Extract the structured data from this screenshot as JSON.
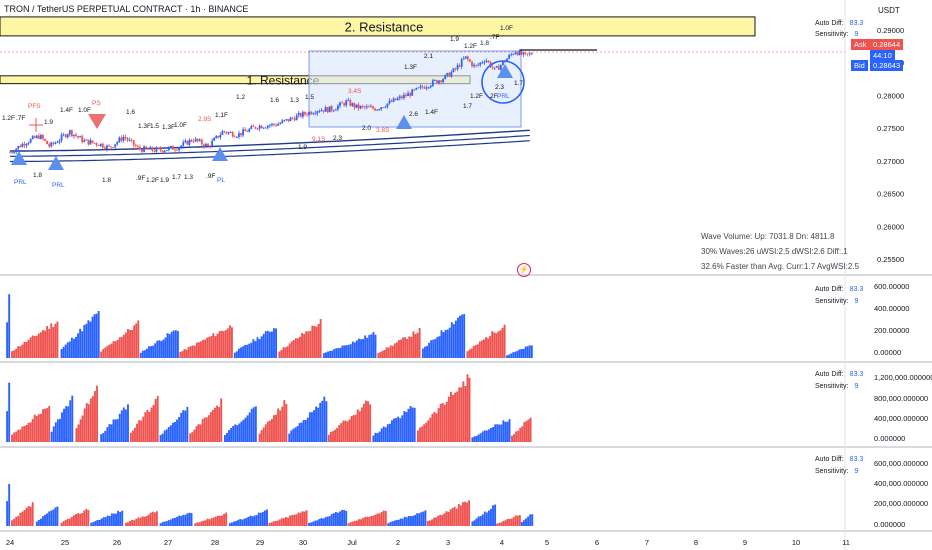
{
  "header": {
    "symbol_title": "TRON / TetherUS PERPETUAL CONTRACT · 1h · BINANCE",
    "currency": "USDT"
  },
  "colors": {
    "up": "#2962ff",
    "down": "#ef5350",
    "resistance_fill": "#fdf6a3",
    "box_fill": "#dbe6fb",
    "box_border": "#7b9df0"
  },
  "indicator_settings": {
    "auto_diff_label": "Auto Diff:",
    "auto_diff_value": "83.3",
    "sensitivity_label": "Sensitivity:",
    "sensitivity_value": "9"
  },
  "quotes": {
    "ask_label": "Ask",
    "ask_value": "0.28644",
    "countdown": "44:10",
    "bid_label": "Bid",
    "bid_value": "0.28643"
  },
  "wave_stats": {
    "line1": "Wave Volume: Up: 7031.8 Dn: 4811.8",
    "line2": "30% Waves:26 uWSI:2.5 dWSI:2.6 Diff:.1",
    "line3": "32.6% Faster than Avg. Curr:1.7 AvgWSI:2.5"
  },
  "chart_data": [
    {
      "type": "candlestick",
      "title": "TRON / TetherUS PERPETUAL CONTRACT · 1h · BINANCE",
      "x_ticks": [
        "24",
        "25",
        "26",
        "27",
        "28",
        "29",
        "30",
        "Jul",
        "2",
        "3",
        "4",
        "5",
        "6",
        "7",
        "8",
        "9",
        "10",
        "11"
      ],
      "y_ticks": [
        "0.29000",
        "0.28500",
        "0.28000",
        "0.27500",
        "0.27000",
        "0.26500",
        "0.26000",
        "0.25500"
      ],
      "ylim": [
        0.2515,
        0.2925
      ],
      "close_path": [
        [
          24.0,
          0.2713
        ],
        [
          24.3,
          0.2728
        ],
        [
          24.6,
          0.2738
        ],
        [
          24.8,
          0.2722
        ],
        [
          25.0,
          0.2733
        ],
        [
          25.2,
          0.2745
        ],
        [
          25.5,
          0.273
        ],
        [
          25.8,
          0.2726
        ],
        [
          26.0,
          0.272
        ],
        [
          26.3,
          0.2737
        ],
        [
          26.6,
          0.2718
        ],
        [
          27.0,
          0.2716
        ],
        [
          27.4,
          0.2721
        ],
        [
          27.7,
          0.2733
        ],
        [
          28.0,
          0.2722
        ],
        [
          28.3,
          0.2745
        ],
        [
          28.6,
          0.274
        ],
        [
          29.0,
          0.2753
        ],
        [
          29.4,
          0.2756
        ],
        [
          29.8,
          0.2768
        ],
        [
          30.2,
          0.2778
        ],
        [
          30.5,
          0.2779
        ],
        [
          30.8,
          0.279
        ],
        [
          31.0,
          0.2782
        ],
        [
          31.4,
          0.278
        ],
        [
          31.7,
          0.279
        ],
        [
          32.0,
          0.28
        ],
        [
          32.4,
          0.2815
        ],
        [
          32.8,
          0.2828
        ],
        [
          33.0,
          0.284
        ],
        [
          33.2,
          0.2858
        ],
        [
          33.4,
          0.2843
        ],
        [
          33.6,
          0.2856
        ],
        [
          33.8,
          0.2838
        ],
        [
          34.0,
          0.2853
        ],
        [
          34.2,
          0.2868
        ],
        [
          34.4,
          0.286
        ],
        [
          34.55,
          0.2864
        ]
      ],
      "annotations": [
        {
          "label": "2. Resistance",
          "kind": "zone",
          "y_range": [
            0.2891,
            0.292
          ]
        },
        {
          "label": "1. Resistance",
          "kind": "zone",
          "y_range": [
            0.2818,
            0.283
          ]
        }
      ]
    },
    {
      "type": "bar",
      "title": "",
      "y_ticks": [
        "600.00000",
        "400.00000",
        "200.00000",
        "0.00000"
      ],
      "ylim": [
        0,
        650
      ],
      "peaks": [
        {
          "x": 24.0,
          "value": 630
        },
        {
          "x": 25.0,
          "value": 350
        },
        {
          "x": 25.8,
          "value": 420
        },
        {
          "x": 26.6,
          "value": 320
        },
        {
          "x": 27.4,
          "value": 270
        },
        {
          "x": 28.5,
          "value": 300
        },
        {
          "x": 29.4,
          "value": 290
        },
        {
          "x": 30.3,
          "value": 340
        },
        {
          "x": 31.4,
          "value": 230
        },
        {
          "x": 32.3,
          "value": 260
        },
        {
          "x": 33.2,
          "value": 430
        },
        {
          "x": 34.0,
          "value": 310
        },
        {
          "x": 34.55,
          "value": 120
        }
      ]
    },
    {
      "type": "bar",
      "title": "",
      "y_ticks": [
        "1,200,000.000000",
        "800,000.000000",
        "400,000.000000",
        "0.000000"
      ],
      "ylim": [
        0,
        1300000
      ],
      "peaks": [
        {
          "x": 24.0,
          "value": 1250000
        },
        {
          "x": 24.8,
          "value": 700000
        },
        {
          "x": 25.3,
          "value": 950000
        },
        {
          "x": 25.8,
          "value": 1200000
        },
        {
          "x": 26.4,
          "value": 700000
        },
        {
          "x": 27.0,
          "value": 850000
        },
        {
          "x": 27.6,
          "value": 650000
        },
        {
          "x": 28.3,
          "value": 800000
        },
        {
          "x": 29.0,
          "value": 700000
        },
        {
          "x": 29.6,
          "value": 800000
        },
        {
          "x": 30.4,
          "value": 850000
        },
        {
          "x": 31.3,
          "value": 800000
        },
        {
          "x": 32.2,
          "value": 700000
        },
        {
          "x": 33.3,
          "value": 1250000
        },
        {
          "x": 34.1,
          "value": 450000
        },
        {
          "x": 34.55,
          "value": 500000
        }
      ]
    },
    {
      "type": "bar",
      "title": "",
      "y_ticks": [
        "600,000.000000",
        "400,000.000000",
        "200,000.000000",
        "0.000000"
      ],
      "ylim": [
        0,
        650000
      ],
      "peaks": [
        {
          "x": 24.0,
          "value": 460000
        },
        {
          "x": 24.5,
          "value": 230000
        },
        {
          "x": 25.0,
          "value": 200000
        },
        {
          "x": 25.6,
          "value": 170000
        },
        {
          "x": 26.3,
          "value": 160000
        },
        {
          "x": 27.0,
          "value": 150000
        },
        {
          "x": 27.7,
          "value": 140000
        },
        {
          "x": 28.4,
          "value": 130000
        },
        {
          "x": 29.2,
          "value": 150000
        },
        {
          "x": 30.0,
          "value": 150000
        },
        {
          "x": 30.8,
          "value": 160000
        },
        {
          "x": 31.6,
          "value": 150000
        },
        {
          "x": 32.4,
          "value": 150000
        },
        {
          "x": 33.3,
          "value": 250000
        },
        {
          "x": 33.8,
          "value": 200000
        },
        {
          "x": 34.3,
          "value": 110000
        },
        {
          "x": 34.55,
          "value": 120000
        }
      ]
    }
  ]
}
